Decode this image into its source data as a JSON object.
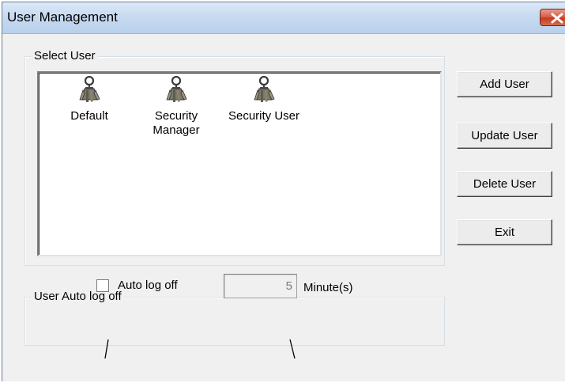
{
  "window": {
    "title": "User Management"
  },
  "select_user": {
    "label": "Select User",
    "users": [
      {
        "name": "Default",
        "icon": "keys-user-icon"
      },
      {
        "name": "Security Manager",
        "icon": "keys-user-icon"
      },
      {
        "name": "Security User",
        "icon": "keys-user-icon"
      }
    ]
  },
  "buttons": {
    "add": "Add User",
    "update": "Update User",
    "delete": "Delete User",
    "exit": "Exit"
  },
  "auto_logoff": {
    "group_label": "User Auto log off",
    "checkbox_label": "Auto log off",
    "checked": false,
    "minutes_value": "5",
    "unit_label": "Minute(s)"
  },
  "colors": {
    "close_button": "#c4391f",
    "titlebar": "#c7daf0",
    "dialog_bg": "#f0f0f0"
  }
}
